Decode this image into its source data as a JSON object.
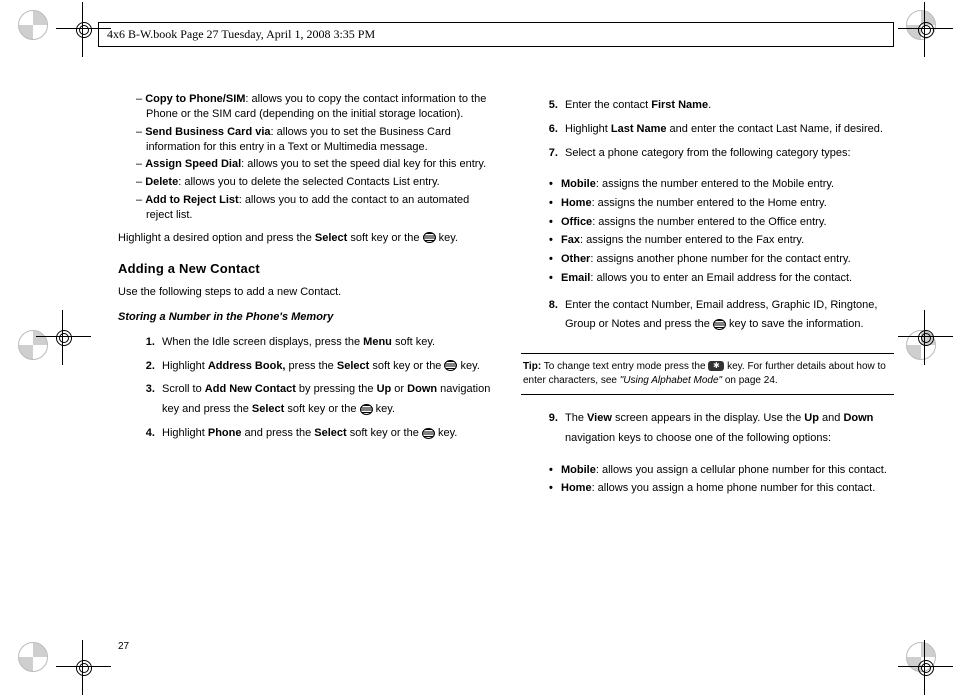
{
  "header": {
    "text": "4x6 B-W.book  Page 27  Tuesday, April 1, 2008  3:35 PM"
  },
  "page_number": "27",
  "left_col": {
    "dash_items": [
      {
        "bold": "Copy to Phone/SIM",
        "rest": ": allows you to copy the contact information to the Phone or the SIM card (depending on the initial storage location)."
      },
      {
        "bold": "Send Business Card via",
        "rest": ": allows you to set the Business Card information for this entry in a Text or Multimedia message."
      },
      {
        "bold": "Assign Speed Dial",
        "rest": ": allows you to set the speed dial key for this entry."
      },
      {
        "bold": "Delete",
        "rest": ": allows you to delete the selected Contacts List entry."
      },
      {
        "bold": "Add to Reject List",
        "rest": ": allows you to add the contact to an automated reject list."
      }
    ],
    "highlight_para_pre": "Highlight a desired option and press the ",
    "highlight_para_bold": "Select",
    "highlight_para_mid": " soft key or the ",
    "highlight_para_post": " key.",
    "heading": "Adding a New Contact",
    "intro": "Use the following steps to add a new Contact.",
    "subheading": "Storing a Number in the Phone's Memory",
    "steps": {
      "s1": {
        "pre": "When the Idle screen displays, press the ",
        "b1": "Menu",
        "post": " soft key."
      },
      "s2": {
        "pre": "Highlight ",
        "b1": "Address Book,",
        "mid": " press the ",
        "b2": "Select",
        "post1": " soft key or the ",
        "post2": " key."
      },
      "s3": {
        "pre": "Scroll to ",
        "b1": "Add New Contact",
        "mid1": " by pressing the ",
        "b2": "Up",
        "mid2": " or ",
        "b3": "Down",
        "mid3": " navigation key and press the ",
        "b4": "Select",
        "post1": " soft key or the ",
        "post2": " key."
      },
      "s4": {
        "pre": "Highlight ",
        "b1": "Phone",
        "mid": " and press the ",
        "b2": "Select",
        "post1": " soft key or the ",
        "post2": " key."
      }
    }
  },
  "right_col": {
    "steps": {
      "s5": {
        "pre": "Enter the contact ",
        "b1": "First Name",
        "post": "."
      },
      "s6": {
        "pre": "Highlight ",
        "b1": "Last Name",
        "post": " and enter the contact Last Name, if desired."
      },
      "s7": {
        "text": "Select a phone category from the following category types:"
      },
      "s8": {
        "pre": "Enter the contact Number, Email address, Graphic ID, Ringtone, Group or Notes and press the ",
        "post": " key to save the information."
      },
      "s9": {
        "pre": "The ",
        "b1": "View",
        "mid1": " screen appears in the display. Use the ",
        "b2": "Up",
        "mid2": " and ",
        "b3": "Down",
        "post": " navigation keys to choose one of the following options:"
      }
    },
    "categories7": [
      {
        "bold": "Mobile",
        "rest": ": assigns the number entered to the Mobile entry."
      },
      {
        "bold": "Home",
        "rest": ": assigns the number entered to the Home entry."
      },
      {
        "bold": "Office",
        "rest": ": assigns the number entered to the Office entry."
      },
      {
        "bold": "Fax",
        "rest": ": assigns the number entered to the Fax entry."
      },
      {
        "bold": "Other",
        "rest": ": assigns another phone number for the contact entry."
      },
      {
        "bold": "Email",
        "rest": ": allows you to enter an Email address for the contact."
      }
    ],
    "tip": {
      "label": "Tip:",
      "pre": " To change text entry mode press the ",
      "mid": " key. For further details about how to enter characters, see ",
      "ref": "\"Using Alphabet Mode\"",
      "post": " on page 24."
    },
    "categories9": [
      {
        "bold": "Mobile",
        "rest": ": allows you assign a cellular phone number for this contact."
      },
      {
        "bold": "Home",
        "rest": ": allows you assign a home phone number for this contact."
      }
    ]
  }
}
